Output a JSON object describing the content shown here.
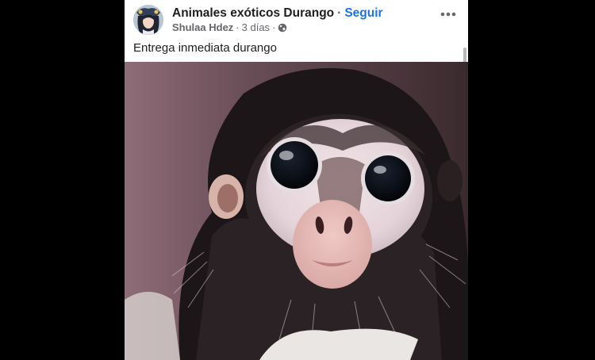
{
  "post": {
    "group_name": "Animales exóticos Durango",
    "separator": "·",
    "follow_label": "Seguir",
    "author": "Shulaa Hdez",
    "time": "3 días",
    "audience_icon": "globe-icon",
    "more_icon": "more-options-icon",
    "caption": "Entrega inmediata durango",
    "photo_subject": "spider-monkey"
  },
  "colors": {
    "follow": "#1b74e4",
    "name_text": "#1c1e21",
    "meta_text": "#65676b",
    "backdrop": "#000000"
  }
}
